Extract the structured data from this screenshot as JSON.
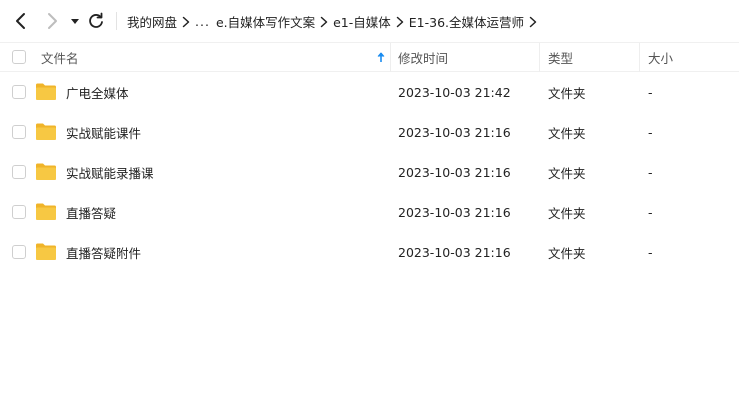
{
  "toolbar": {
    "back_icon": "chevron-left-icon",
    "forward_icon": "chevron-right-icon",
    "dropdown_icon": "caret-down-icon",
    "refresh_icon": "refresh-icon"
  },
  "breadcrumb": {
    "root": "我的网盘",
    "ellipsis": "...",
    "items": [
      "e.自媒体写作文案",
      "e1-自媒体",
      "E1-36.全媒体运营师"
    ]
  },
  "columns": {
    "name": "文件名",
    "modified": "修改时间",
    "type": "类型",
    "size": "大小",
    "sort_icon": "arrow-up-icon"
  },
  "files": [
    {
      "name": "广电全媒体",
      "modified": "2023-10-03 21:42",
      "type": "文件夹",
      "size": "-"
    },
    {
      "name": "实战赋能课件",
      "modified": "2023-10-03 21:16",
      "type": "文件夹",
      "size": "-"
    },
    {
      "name": "实战赋能录播课",
      "modified": "2023-10-03 21:16",
      "type": "文件夹",
      "size": "-"
    },
    {
      "name": "直播答疑",
      "modified": "2023-10-03 21:16",
      "type": "文件夹",
      "size": "-"
    },
    {
      "name": "直播答疑附件",
      "modified": "2023-10-03 21:16",
      "type": "文件夹",
      "size": "-"
    }
  ],
  "colors": {
    "folder": "#f7c843",
    "folder_dark": "#f0b429",
    "sort_arrow": "#1a8cf0"
  }
}
